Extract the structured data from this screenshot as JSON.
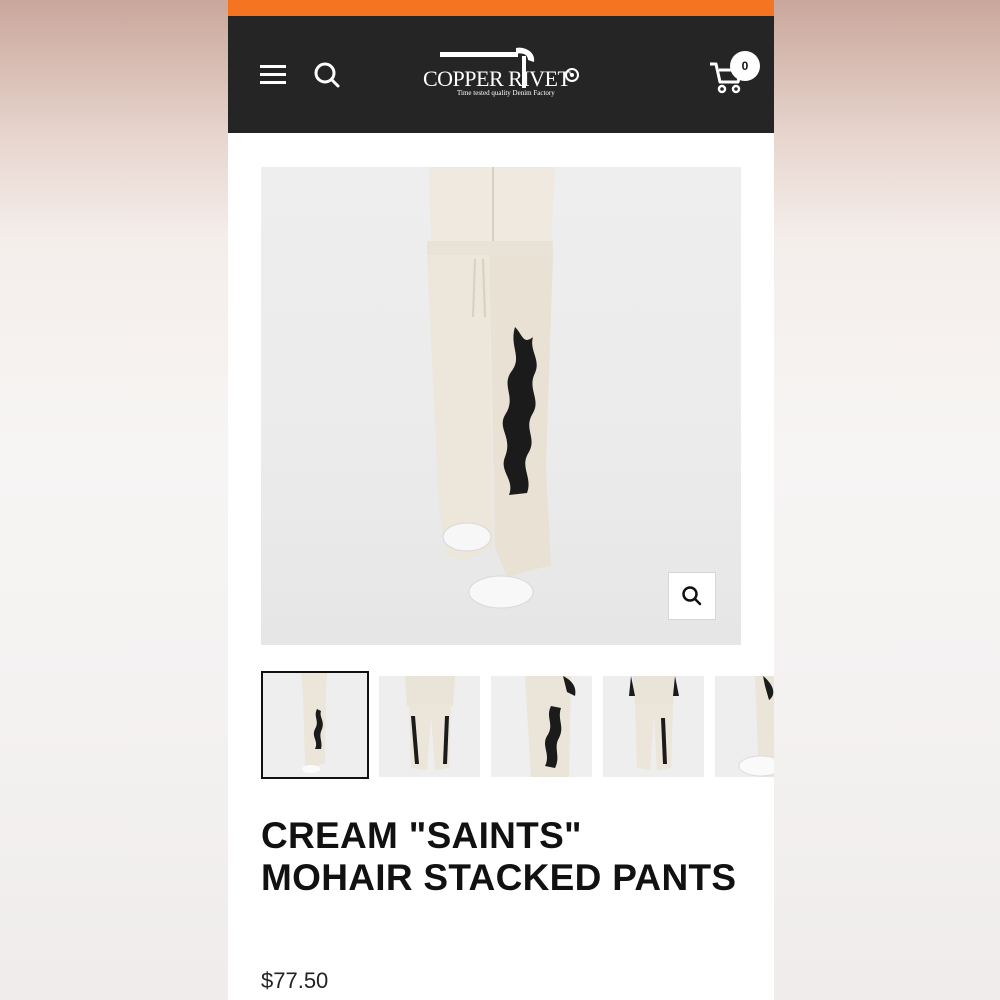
{
  "header": {
    "brand_name": "COPPER RIVET",
    "brand_tagline": "Time tested quality Denim Factory",
    "cart_count": "0",
    "menu_icon": "hamburger-menu-icon",
    "search_icon": "search-icon",
    "cart_icon": "shopping-cart-icon",
    "accent_color": "#f47422",
    "header_bg": "#252525"
  },
  "product": {
    "title": "CREAM \"SAINTS\" MOHAIR STACKED PANTS",
    "price": "$77.50",
    "zoom_icon": "zoom-search-icon",
    "thumbnail_count_visible": 5,
    "selected_thumbnail": 1
  }
}
